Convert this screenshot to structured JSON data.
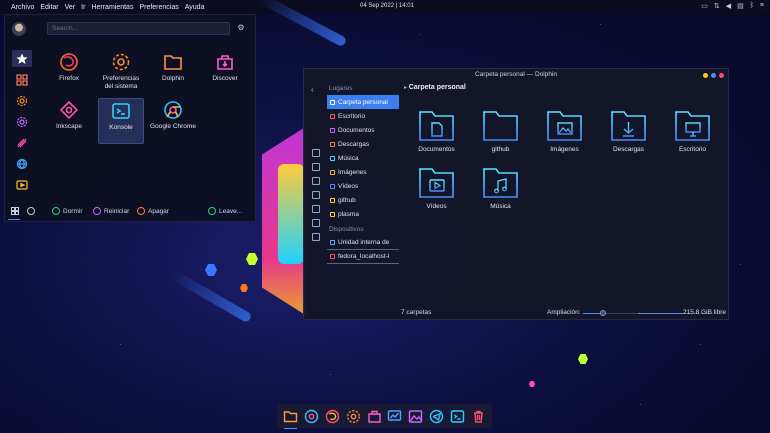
{
  "topbar": {
    "menu": [
      "Archivo",
      "Editar",
      "Ver",
      "Ir",
      "Herramientas",
      "Preferencias",
      "Ayuda"
    ],
    "clock": "04 Sep 2022 | 14:01",
    "tray_icons": [
      "screen-icon",
      "network-icon",
      "volume-icon",
      "clipboard-icon",
      "bluetooth-icon",
      "hamburger-icon"
    ]
  },
  "launcher": {
    "search_placeholder": "Search...",
    "categories": [
      "favorites-icon",
      "all-apps-icon",
      "settings-icon",
      "system-icon",
      "development-icon",
      "internet-icon",
      "multimedia-icon"
    ],
    "apps": [
      {
        "label": "Firefox",
        "icon": "firefox-icon",
        "color": "#ff7b2c"
      },
      {
        "label": "Preferencias del sistema",
        "icon": "gear-icon",
        "color": "#ff8a25"
      },
      {
        "label": "Dolphin",
        "icon": "folder-icon",
        "color": "#ff9540"
      },
      {
        "label": "Discover",
        "icon": "discover-icon",
        "color": "#ff5bd0"
      },
      {
        "label": "Inkscape",
        "icon": "inkscape-icon",
        "color": "#ff4fa8"
      },
      {
        "label": "Konsole",
        "icon": "terminal-icon",
        "color": "#31d0ff"
      },
      {
        "label": "Google Chrome",
        "icon": "chrome-icon",
        "color": "#33c2ff"
      }
    ],
    "footer": {
      "sleep": "Dormir",
      "restart": "Reiniciar",
      "shutdown": "Apagar",
      "leave": "Leave..."
    }
  },
  "dolphin": {
    "title": "Carpeta personal — Dolphin",
    "places_header": "Lugares",
    "places": [
      {
        "label": "Carpeta personal",
        "color": "#4d8df7"
      },
      {
        "label": "Escritorio",
        "color": "#ff4d6a"
      },
      {
        "label": "Documentos",
        "color": "#c868ff"
      },
      {
        "label": "Descargas",
        "color": "#ff7b3a"
      },
      {
        "label": "Música",
        "color": "#43e3ff"
      },
      {
        "label": "Imágenes",
        "color": "#ffb630"
      },
      {
        "label": "Vídeos",
        "color": "#5a8cff"
      },
      {
        "label": "github",
        "color": "#ffd23a"
      },
      {
        "label": "plasma",
        "color": "#ffd23a"
      }
    ],
    "devices_header": "Dispositivos",
    "devices": [
      {
        "label": "Unidad interna de",
        "color": "#6aa8ff"
      },
      {
        "label": "fedora_localhost-l",
        "color": "#ff4d6a"
      }
    ],
    "breadcrumb": "Carpeta personal",
    "folders": [
      {
        "label": "Documentos",
        "glyph": "document-icon"
      },
      {
        "label": "github",
        "glyph": "folder-icon"
      },
      {
        "label": "Imágenes",
        "glyph": "image-icon"
      },
      {
        "label": "Descargas",
        "glyph": "download-icon"
      },
      {
        "label": "Escritorio",
        "glyph": "desktop-icon"
      },
      {
        "label": "Vídeos",
        "glyph": "video-icon"
      },
      {
        "label": "Música",
        "glyph": "music-icon"
      }
    ],
    "status": {
      "folders": "7 carpetas",
      "zoom_label": "Ampliación:",
      "zoom_value": 0.15,
      "free_space": "215.8 GiB libre"
    }
  },
  "dock": {
    "items": [
      "folder-icon",
      "chrome-icon",
      "firefox-icon",
      "gear-icon",
      "discover-icon",
      "monitor-icon",
      "image-viewer-icon",
      "telegram-icon",
      "terminal-icon",
      "trash-icon"
    ]
  },
  "colors": {
    "accent": "#4d8df7",
    "folder_stroke_top": "#5ce1ff",
    "folder_stroke_bottom": "#4d8df7"
  }
}
